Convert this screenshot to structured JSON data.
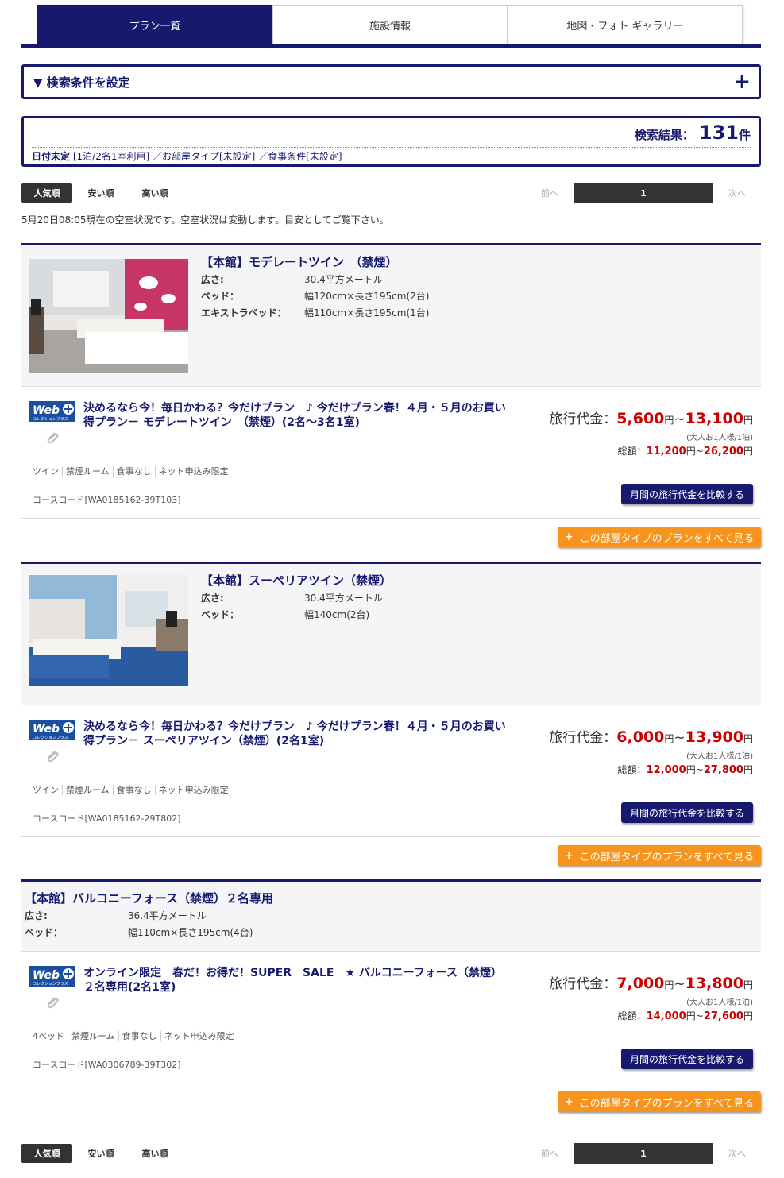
{
  "tabs": [
    {
      "label": "プラン一覧",
      "active": true
    },
    {
      "label": "施設情報",
      "active": false
    },
    {
      "label": "地図・フォト ギャラリー",
      "active": false
    }
  ],
  "search_condition": {
    "label": "▼ 検索条件を設定",
    "toggle": "+"
  },
  "results": {
    "label": "検索結果：",
    "count": "131",
    "unit": "件",
    "date": "日付未定",
    "info": "[1泊/2名1室利用] ／お部屋タイプ[未設定] ／食事条件[未設定]"
  },
  "sort": {
    "popular": "人気順",
    "cheap": "安い順",
    "expensive": "高い順",
    "prev": "前へ",
    "page": "1",
    "next": "次へ"
  },
  "notice": "5月20日08:05現在の空室状況です。空室状況は変動します。目安としてご覧下さい。",
  "rooms": [
    {
      "name": "【本館】モデレートツイン　（禁煙）",
      "specs": [
        {
          "k": "広さ:",
          "v": "30.4平方メートル"
        },
        {
          "k": "ベッド：",
          "v": "幅120cm×長さ195cm(2台)"
        },
        {
          "k": "エキストラベッド：",
          "v": "幅110cm×長さ195cm(1台)"
        }
      ],
      "plan_title": "決めるなら今！毎日かわる？今だけプラン　♪ 今だけプラン春！４月・５月のお買い得プラン－ モデレートツイン　（禁煙）(2名～3名1室)",
      "tags": [
        "ツイン",
        "禁煙ルーム",
        "食事なし",
        "ネット申込み限定"
      ],
      "code": "コースコード[WA0185162-39T103]",
      "price_label": "旅行代金：",
      "price_min": "5,600",
      "price_max": "13,100",
      "yen": "円",
      "tilde": "~",
      "note": "(大人お1人様/1泊)",
      "total_label": "総額：",
      "total_min": "11,200",
      "total_max": "26,200",
      "compare": "月間の旅行代金を比較する",
      "all": "この部屋タイプのプランをすべて見る"
    },
    {
      "name": "【本館】スーペリアツイン（禁煙）",
      "specs": [
        {
          "k": "広さ:",
          "v": "30.4平方メートル"
        },
        {
          "k": "ベッド：",
          "v": "幅140cm(2台)"
        }
      ],
      "plan_title": "決めるなら今！毎日かわる？今だけプラン　♪ 今だけプラン春！４月・５月のお買い得プラン－ スーペリアツイン（禁煙）(2名1室)",
      "tags": [
        "ツイン",
        "禁煙ルーム",
        "食事なし",
        "ネット申込み限定"
      ],
      "code": "コースコード[WA0185162-29T802]",
      "price_label": "旅行代金：",
      "price_min": "6,000",
      "price_max": "13,900",
      "yen": "円",
      "tilde": "~",
      "note": "(大人お1人様/1泊)",
      "total_label": "総額：",
      "total_min": "12,000",
      "total_max": "27,800",
      "compare": "月間の旅行代金を比較する",
      "all": "この部屋タイプのプランをすべて見る"
    },
    {
      "name": "【本館】バルコニーフォース（禁煙）２名専用",
      "specs": [
        {
          "k": "広さ:",
          "v": "36.4平方メートル"
        },
        {
          "k": "ベッド：",
          "v": "幅110cm×長さ195cm(4台)"
        }
      ],
      "plan_title": "オンライン限定　春だ！お得だ！SUPER　SALE　★ バルコニーフォース（禁煙）２名専用(2名1室)",
      "tags": [
        "4ベッド",
        "禁煙ルーム",
        "食事なし",
        "ネット申込み限定"
      ],
      "code": "コースコード[WA0306789-39T302]",
      "price_label": "旅行代金：",
      "price_min": "7,000",
      "price_max": "13,800",
      "yen": "円",
      "tilde": "~",
      "note": "(大人お1人様/1泊)",
      "total_label": "総額：",
      "total_min": "14,000",
      "total_max": "27,600",
      "compare": "月間の旅行代金を比較する",
      "all": "この部屋タイプのプランをすべて見る"
    }
  ],
  "logo": {
    "text": "Web",
    "sub": "コレクションプラス"
  }
}
